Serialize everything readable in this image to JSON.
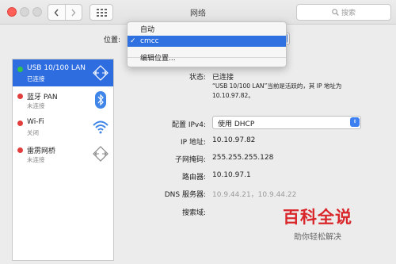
{
  "window": {
    "title": "网络"
  },
  "search": {
    "placeholder": "搜索"
  },
  "location": {
    "label": "位置:",
    "options": [
      "自动",
      "cmcc",
      "编辑位置..."
    ],
    "selected": "cmcc"
  },
  "services": [
    {
      "name": "USB 10/100 LAN",
      "status": "已连接",
      "dot": "#32c24d",
      "icon": "ethernet-icon"
    },
    {
      "name": "蓝牙 PAN",
      "status": "未连接",
      "dot": "#e23d3d",
      "icon": "bluetooth-icon"
    },
    {
      "name": "Wi-Fi",
      "status": "关闭",
      "dot": "#e23d3d",
      "icon": "wifi-icon"
    },
    {
      "name": "雷雳网桥",
      "status": "未连接",
      "dot": "#e23d3d",
      "icon": "bridge-icon"
    }
  ],
  "detail": {
    "status_label": "状态:",
    "status_value": "已连接",
    "status_desc": "“USB 10/100 LAN”当前是活跃的，其 IP 地址为 10.10.97.82。",
    "ipv4_label": "配置 IPv4:",
    "ipv4_value": "使用 DHCP",
    "ip_label": "IP 地址:",
    "ip_value": "10.10.97.82",
    "mask_label": "子网掩码:",
    "mask_value": "255.255.255.128",
    "router_label": "路由器:",
    "router_value": "10.10.97.1",
    "dns_label": "DNS 服务器:",
    "dns_value": "10.9.44.21，10.9.44.22",
    "domain_label": "搜索域:"
  },
  "watermark": {
    "title": "百科全说",
    "subtitle": "助你轻松解决"
  },
  "colors": {
    "accent": "#2d6de0",
    "connected": "#32c24d",
    "disconnected": "#e23d3d",
    "watermark": "#d9262a"
  }
}
